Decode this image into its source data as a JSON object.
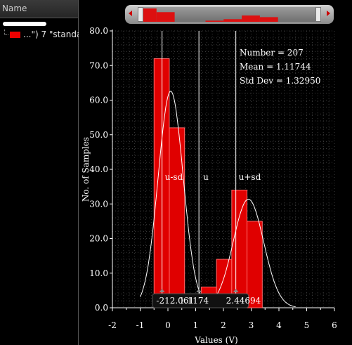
{
  "panel": {
    "header": "Name",
    "series_label": "...\") 7 \"standa"
  },
  "chart_data": {
    "type": "bar",
    "xlabel": "Values (V)",
    "ylabel": "No. of Samples",
    "xlim": [
      -2,
      6
    ],
    "ylim": [
      0,
      80
    ],
    "xticks": [
      -2,
      -1,
      0,
      1,
      2,
      3,
      4,
      5,
      6
    ],
    "yticks": [
      "0.0",
      "10.0",
      "20.0",
      "30.0",
      "40.0",
      "50.0",
      "60.0",
      "70.0",
      "80.0"
    ],
    "bins": [
      {
        "x0": -0.5,
        "x1": 0.05,
        "value": 72
      },
      {
        "x0": 0.05,
        "x1": 0.6,
        "value": 52
      },
      {
        "x0": 1.2,
        "x1": 1.75,
        "value": 6
      },
      {
        "x0": 1.75,
        "x1": 2.3,
        "value": 14
      },
      {
        "x0": 2.3,
        "x1": 2.85,
        "value": 34
      },
      {
        "x0": 2.85,
        "x1": 3.4,
        "value": 25
      }
    ],
    "curve": {
      "components": [
        {
          "weight": 0.62,
          "mean": 0.1,
          "sd": 0.45
        },
        {
          "weight": 0.38,
          "mean": 2.9,
          "sd": 0.55
        }
      ],
      "bin_width": 0.55,
      "n": 207
    },
    "markers": [
      {
        "label": "u-sd",
        "value": -0.212061
      },
      {
        "label": "u",
        "value": 1.1174
      },
      {
        "label": "u+sd",
        "value": 2.44694
      }
    ],
    "marker_readouts": [
      "-212.061",
      "1.1174",
      "2.44694"
    ],
    "stats": [
      "Number = 207",
      "Mean = 1.11744",
      "Std Dev = 1.32950"
    ],
    "grid": true,
    "colors": {
      "bar": "#e00000",
      "curve": "#ffffff",
      "grid": "#3c3c3c",
      "background": "#000000"
    }
  },
  "scroller": {
    "colors": {
      "bars": "#dd1010"
    },
    "overview_bars": [
      {
        "x0": 0.0,
        "x1": 0.1,
        "value": 72
      },
      {
        "x0": 0.1,
        "x1": 0.2,
        "value": 52
      },
      {
        "x0": 0.37,
        "x1": 0.47,
        "value": 6
      },
      {
        "x0": 0.47,
        "x1": 0.57,
        "value": 14
      },
      {
        "x0": 0.57,
        "x1": 0.67,
        "value": 34
      },
      {
        "x0": 0.67,
        "x1": 0.77,
        "value": 25
      }
    ]
  }
}
